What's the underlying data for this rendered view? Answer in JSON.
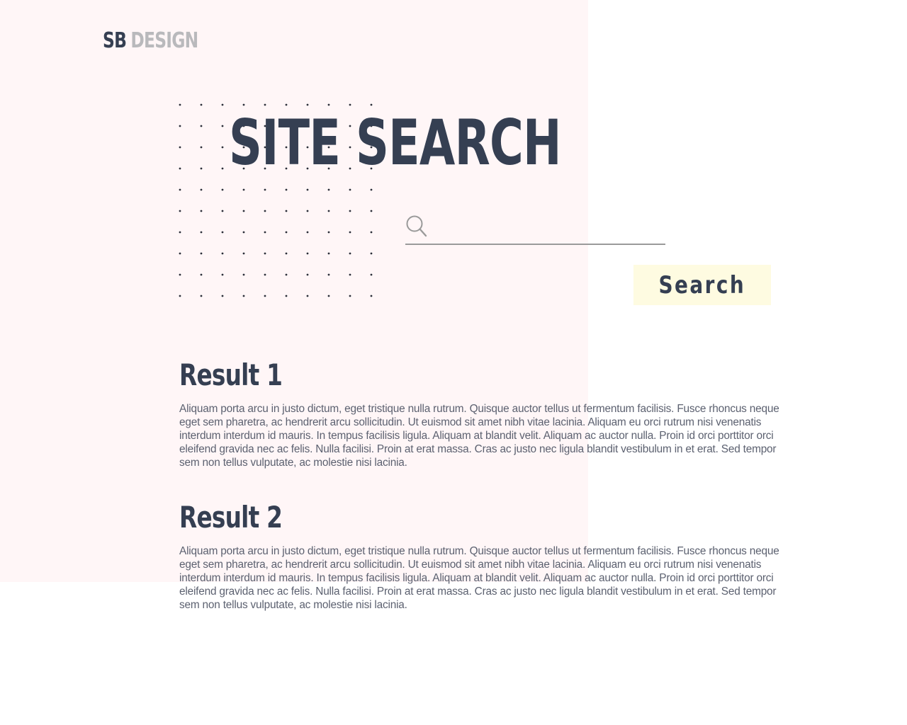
{
  "brand": {
    "logo_primary": "SB",
    "logo_secondary": "DESIGN"
  },
  "page": {
    "title": "SITE SEARCH"
  },
  "search": {
    "value": "",
    "placeholder": "",
    "button_label": "Search",
    "icon": "search-icon"
  },
  "results": [
    {
      "title": "Result 1",
      "body": "Aliquam porta arcu in justo dictum, eget tristique nulla rutrum. Quisque auctor tellus ut fermentum facilisis. Fusce rhoncus neque eget sem pharetra, ac hendrerit arcu sollicitudin. Ut euismod sit amet nibh vitae lacinia. Aliquam eu orci rutrum nisi venenatis interdum interdum id mauris. In tempus facilisis ligula. Aliquam at blandit velit. Aliquam ac auctor nulla. Proin id orci porttitor orci eleifend gravida nec ac felis. Nulla facilisi. Proin at erat massa. Cras ac justo nec ligula blandit vestibulum in et erat. Sed tempor sem non tellus vulputate, ac molestie nisi lacinia."
    },
    {
      "title": "Result 2",
      "body": "Aliquam porta arcu in justo dictum, eget tristique nulla rutrum. Quisque auctor tellus ut fermentum facilisis. Fusce rhoncus neque eget sem pharetra, ac hendrerit arcu sollicitudin. Ut euismod sit amet nibh vitae lacinia. Aliquam eu orci rutrum nisi venenatis interdum interdum id mauris. In tempus facilisis ligula. Aliquam at blandit velit. Aliquam ac auctor nulla. Proin id orci porttitor orci eleifend gravida nec ac felis. Nulla facilisi. Proin at erat massa. Cras ac justo nec ligula blandit vestibulum in et erat. Sed tempor sem non tellus vulputate, ac molestie nisi lacinia."
    }
  ],
  "colors": {
    "panel_background": "#fff6f7",
    "heading": "#353f52",
    "logo_muted": "#b9b9bc",
    "body_text": "#5c6170",
    "button_background": "#fefbe1",
    "input_underline": "#9a9a9a"
  }
}
